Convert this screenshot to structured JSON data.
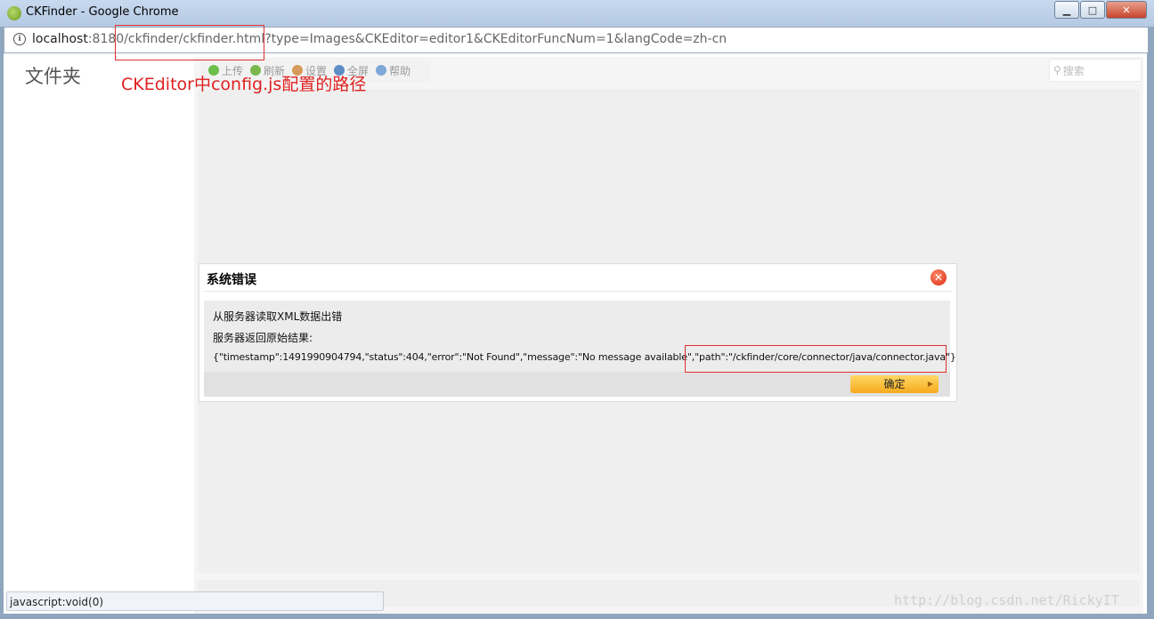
{
  "window": {
    "title": "CKFinder - Google Chrome",
    "minimize_label": "▁",
    "maximize_label": "□",
    "close_label": "✕"
  },
  "address": {
    "host": "localhost",
    "port": ":8180",
    "path": "/ckfinder/ckfinder.html",
    "query": "?type=Images&CKEditor=editor1&CKEditorFuncNum=1&langCode=zh-cn"
  },
  "annotation": "CKEditor中config.js配置的路径",
  "sidebar": {
    "title": "文件夹"
  },
  "toolbar": {
    "items": [
      {
        "label": "上传",
        "icon": "upload-icon",
        "color": "#6cbf4a"
      },
      {
        "label": "刷新",
        "icon": "refresh-icon",
        "color": "#7ab84e"
      },
      {
        "label": "设置",
        "icon": "settings-icon",
        "color": "#d79a5a"
      },
      {
        "label": "全屏",
        "icon": "fullscreen-icon",
        "color": "#5d8dc5"
      },
      {
        "label": "帮助",
        "icon": "help-icon",
        "color": "#7fa7d8"
      }
    ]
  },
  "search": {
    "placeholder": "搜索"
  },
  "dialog": {
    "title": "系统错误",
    "message": "从服务器读取XML数据出错",
    "raw_label": "服务器返回原始结果:",
    "raw_result": "{\"timestamp\":1491990904794,\"status\":404,\"error\":\"Not Found\",\"message\":\"No message available\",\"path\":\"/ckfinder/core/connector/java/connector.java\"}",
    "ok_label": "确定"
  },
  "status_bar": {
    "text": "javascript:void(0)"
  },
  "watermark": "http://blog.csdn.net/RickyIT",
  "colors": {
    "annotation": "#e02020",
    "ok_button": "#f5a91c",
    "close_button": "#d8290e"
  }
}
